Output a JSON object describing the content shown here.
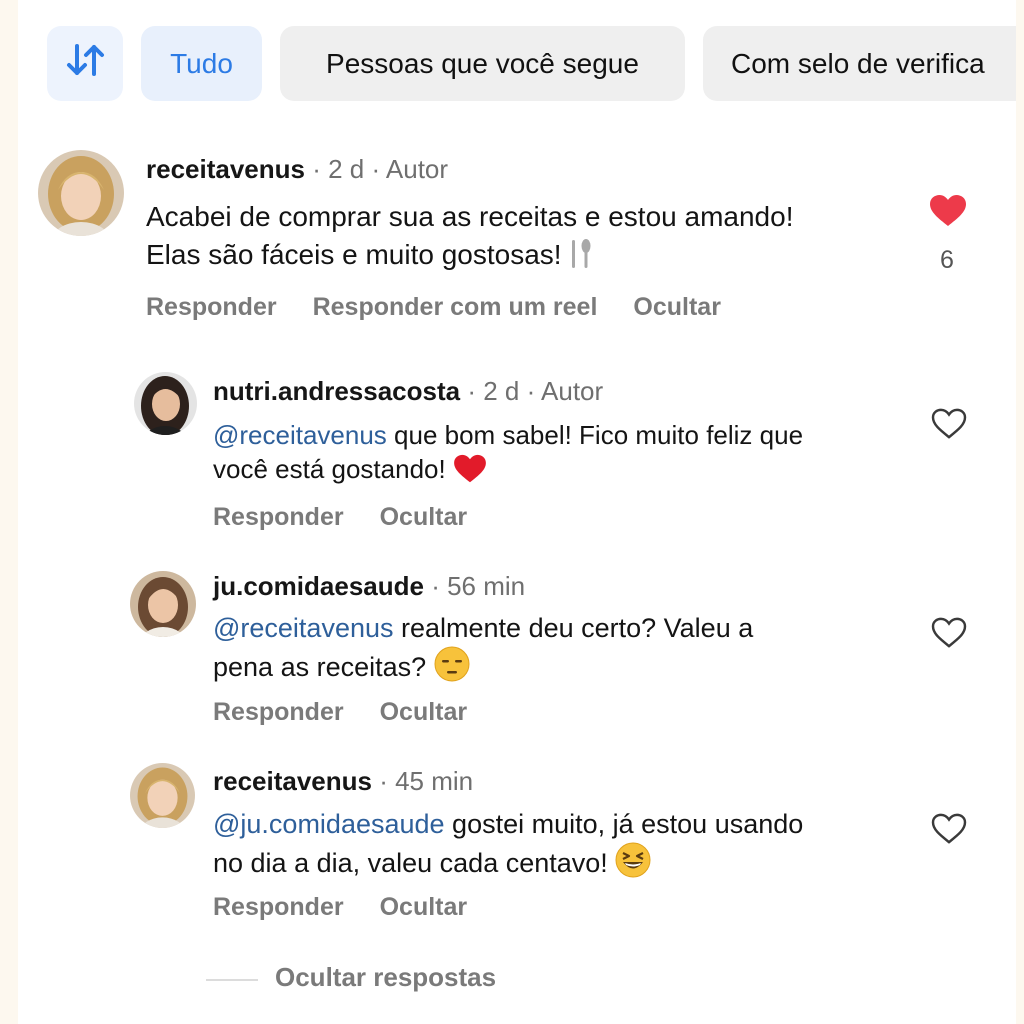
{
  "filters": {
    "sort_icon": "sort-arrows-icon",
    "chips": [
      "Tudo",
      "Pessoas que você segue",
      "Com selo de verifica"
    ]
  },
  "colors": {
    "accent": "#2c7be5",
    "mention": "#2e5f9a",
    "like_red": "#ed3a4a"
  },
  "comment": {
    "username": "receitavenus",
    "meta": " · 2 d · Autor",
    "text": "Acabei de comprar sua as receitas e estou amando! Elas são fáceis e muito gostosas!",
    "emoji": "fork-knife-icon",
    "likes": "6",
    "liked": true,
    "actions": [
      "Responder",
      "Responder com um reel",
      "Ocultar"
    ]
  },
  "replies": [
    {
      "username": "nutri.andressacosta",
      "meta": " · 2 d · Autor",
      "mention": "@receitavenus",
      "text": " que bom sabel! Fico muito feliz que você está gostando!",
      "emoji": "red-heart-icon",
      "actions": [
        "Responder",
        "Ocultar"
      ]
    },
    {
      "username": "ju.comidaesaude",
      "meta": " · 56 min",
      "mention": "@receitavenus",
      "text": " realmente deu certo? Valeu a pena as receitas?",
      "emoji": "unamused-face-icon",
      "actions": [
        "Responder",
        "Ocultar"
      ]
    },
    {
      "username": "receitavenus",
      "meta": " · 45 min",
      "mention": "@ju.comidaesaude",
      "text": " gostei muito, já estou usando no dia a dia, valeu cada centavo!",
      "emoji": "grinning-squinting-face-icon",
      "actions": [
        "Responder",
        "Ocultar"
      ]
    }
  ],
  "hide_replies": "Ocultar respostas"
}
